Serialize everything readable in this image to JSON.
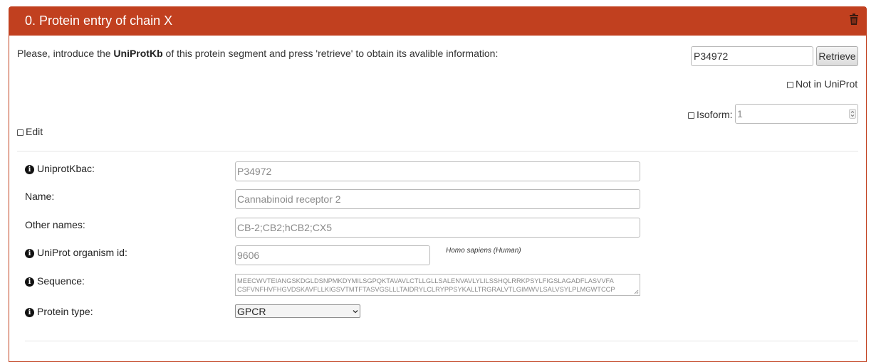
{
  "panel": {
    "title": "0. Protein entry of chain X",
    "delete_icon": "trash-icon",
    "header_color": "#c1401f"
  },
  "intro": {
    "prefix": "Please, introduce the ",
    "bold": "UniProtKb",
    "suffix": " of this protein segment and press 'retrieve' to obtain its avalible information:"
  },
  "uniprot_input": {
    "value": "P34972"
  },
  "retrieve_button": {
    "label": "Retrieve"
  },
  "not_in_uniprot": {
    "label": "Not in UniProt",
    "checked": false
  },
  "isoform": {
    "label": "Isoform:",
    "value": "1",
    "checked": false
  },
  "edit": {
    "label": "Edit",
    "checked": false
  },
  "fields": {
    "uniprotkbac": {
      "label": "UniprotKbac:",
      "value": "P34972"
    },
    "name": {
      "label": "Name:",
      "value": "Cannabinoid receptor 2"
    },
    "other_names": {
      "label": "Other names:",
      "value": "CB-2;CB2;hCB2;CX5"
    },
    "organism": {
      "label": "UniProt organism id:",
      "value": "9606",
      "organism_name": "Homo sapiens (Human)"
    },
    "sequence": {
      "label": "Sequence:",
      "line1": "MEECWVTEIANGSKDGLDSNPMKDYMILSGPQKTAVAVLCTLLGLLSALENVAVLYLILSSHQLRRKPSYLFIGSLAGADFLASVVFA",
      "line2": "CSFVNFHVFHGVDSKAVFLLKIGSVTMTFTASVGSLLLTAIDRYLCLRYPPSYKALLTRGRALVTLGIMWVLSALVSYLPLMGWTCCP"
    },
    "protein_type": {
      "label": "Protein type:",
      "value": "GPCR"
    }
  }
}
